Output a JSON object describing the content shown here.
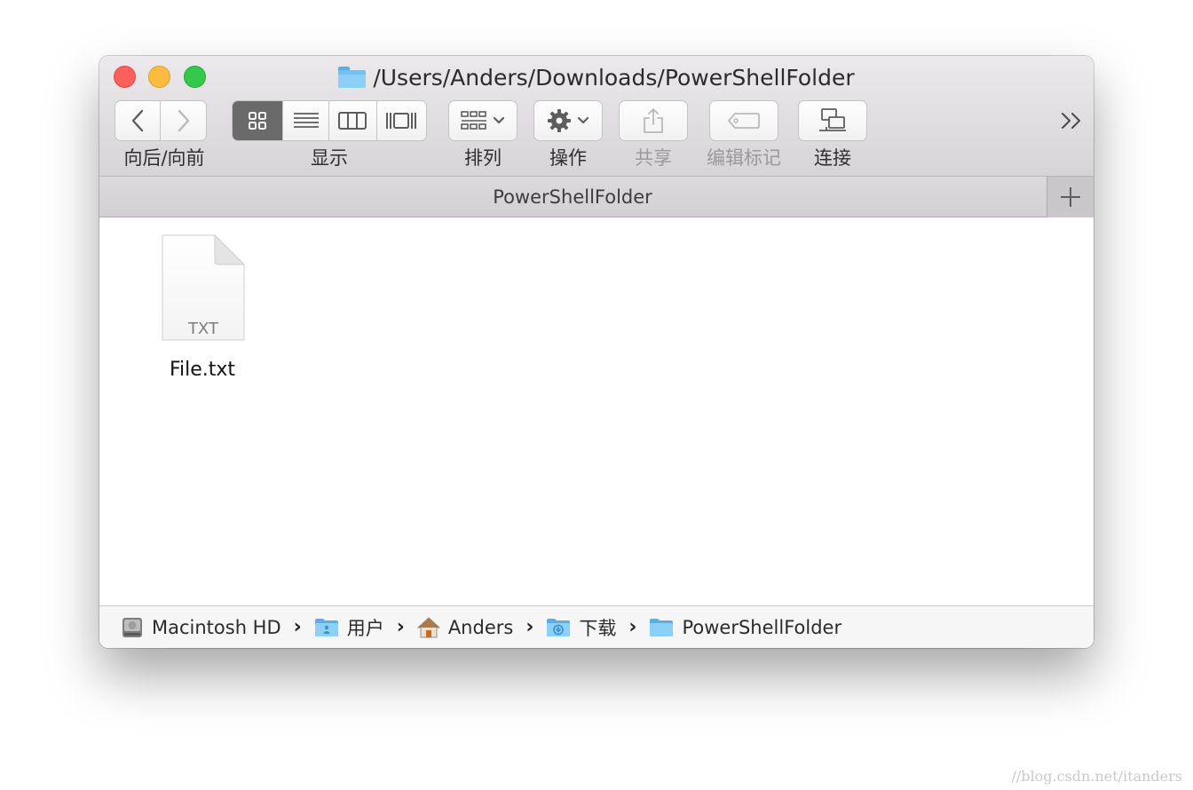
{
  "window": {
    "title": "/Users/Anders/Downloads/PowerShellFolder"
  },
  "toolbar": {
    "back_forward_label": "向后/向前",
    "view_label": "显示",
    "arrange_label": "排列",
    "action_label": "操作",
    "share_label": "共享",
    "tags_label": "编辑标记",
    "connect_label": "连接",
    "overflow_glyph": "››",
    "active_view": "icon"
  },
  "tab": {
    "title": "PowerShellFolder",
    "add_glyph": "+"
  },
  "files": [
    {
      "name": "File.txt",
      "ext": "TXT"
    }
  ],
  "pathbar": [
    {
      "label": "Macintosh HD",
      "icon": "hard-drive-icon"
    },
    {
      "label": "用户",
      "icon": "users-folder-icon"
    },
    {
      "label": "Anders",
      "icon": "home-icon"
    },
    {
      "label": "下载",
      "icon": "downloads-folder-icon"
    },
    {
      "label": "PowerShellFolder",
      "icon": "folder-icon"
    }
  ],
  "watermark": "//blog.csdn.net/itanders",
  "colors": {
    "close": "#fc605c",
    "minimize": "#fdbc40",
    "maximize": "#34c84a",
    "folder": "#6fc1f1"
  }
}
